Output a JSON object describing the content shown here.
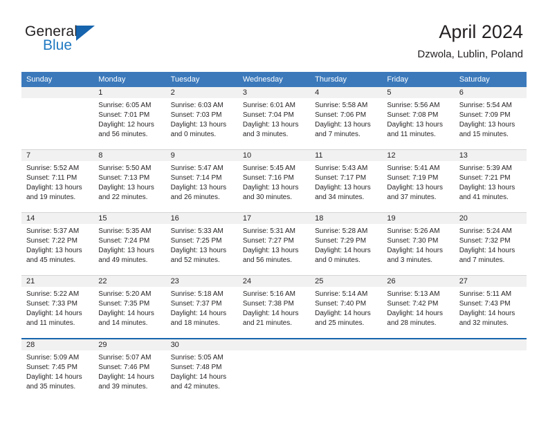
{
  "logo": {
    "word1": "General",
    "word2": "Blue",
    "triangle_icon": "triangle-icon",
    "accent_color": "#1664ad",
    "blue_text_color": "#1f78c1"
  },
  "header": {
    "title": "April 2024",
    "subtitle": "Dzwola, Lublin, Poland"
  },
  "calendar": {
    "header_bg": "#3b79bb",
    "daynum_band_bg": "#f1f1f1",
    "weekdays": [
      "Sunday",
      "Monday",
      "Tuesday",
      "Wednesday",
      "Thursday",
      "Friday",
      "Saturday"
    ],
    "weeks": [
      {
        "separator": "none",
        "days": [
          {
            "num": "",
            "sunrise": "",
            "sunset": "",
            "daylight_line1": "",
            "daylight_line2": "",
            "empty": true
          },
          {
            "num": "1",
            "sunrise": "Sunrise: 6:05 AM",
            "sunset": "Sunset: 7:01 PM",
            "daylight_line1": "Daylight: 12 hours",
            "daylight_line2": "and 56 minutes."
          },
          {
            "num": "2",
            "sunrise": "Sunrise: 6:03 AM",
            "sunset": "Sunset: 7:03 PM",
            "daylight_line1": "Daylight: 13 hours",
            "daylight_line2": "and 0 minutes."
          },
          {
            "num": "3",
            "sunrise": "Sunrise: 6:01 AM",
            "sunset": "Sunset: 7:04 PM",
            "daylight_line1": "Daylight: 13 hours",
            "daylight_line2": "and 3 minutes."
          },
          {
            "num": "4",
            "sunrise": "Sunrise: 5:58 AM",
            "sunset": "Sunset: 7:06 PM",
            "daylight_line1": "Daylight: 13 hours",
            "daylight_line2": "and 7 minutes."
          },
          {
            "num": "5",
            "sunrise": "Sunrise: 5:56 AM",
            "sunset": "Sunset: 7:08 PM",
            "daylight_line1": "Daylight: 13 hours",
            "daylight_line2": "and 11 minutes."
          },
          {
            "num": "6",
            "sunrise": "Sunrise: 5:54 AM",
            "sunset": "Sunset: 7:09 PM",
            "daylight_line1": "Daylight: 13 hours",
            "daylight_line2": "and 15 minutes."
          }
        ]
      },
      {
        "separator": "gray",
        "days": [
          {
            "num": "7",
            "sunrise": "Sunrise: 5:52 AM",
            "sunset": "Sunset: 7:11 PM",
            "daylight_line1": "Daylight: 13 hours",
            "daylight_line2": "and 19 minutes."
          },
          {
            "num": "8",
            "sunrise": "Sunrise: 5:50 AM",
            "sunset": "Sunset: 7:13 PM",
            "daylight_line1": "Daylight: 13 hours",
            "daylight_line2": "and 22 minutes."
          },
          {
            "num": "9",
            "sunrise": "Sunrise: 5:47 AM",
            "sunset": "Sunset: 7:14 PM",
            "daylight_line1": "Daylight: 13 hours",
            "daylight_line2": "and 26 minutes."
          },
          {
            "num": "10",
            "sunrise": "Sunrise: 5:45 AM",
            "sunset": "Sunset: 7:16 PM",
            "daylight_line1": "Daylight: 13 hours",
            "daylight_line2": "and 30 minutes."
          },
          {
            "num": "11",
            "sunrise": "Sunrise: 5:43 AM",
            "sunset": "Sunset: 7:17 PM",
            "daylight_line1": "Daylight: 13 hours",
            "daylight_line2": "and 34 minutes."
          },
          {
            "num": "12",
            "sunrise": "Sunrise: 5:41 AM",
            "sunset": "Sunset: 7:19 PM",
            "daylight_line1": "Daylight: 13 hours",
            "daylight_line2": "and 37 minutes."
          },
          {
            "num": "13",
            "sunrise": "Sunrise: 5:39 AM",
            "sunset": "Sunset: 7:21 PM",
            "daylight_line1": "Daylight: 13 hours",
            "daylight_line2": "and 41 minutes."
          }
        ]
      },
      {
        "separator": "gray",
        "days": [
          {
            "num": "14",
            "sunrise": "Sunrise: 5:37 AM",
            "sunset": "Sunset: 7:22 PM",
            "daylight_line1": "Daylight: 13 hours",
            "daylight_line2": "and 45 minutes."
          },
          {
            "num": "15",
            "sunrise": "Sunrise: 5:35 AM",
            "sunset": "Sunset: 7:24 PM",
            "daylight_line1": "Daylight: 13 hours",
            "daylight_line2": "and 49 minutes."
          },
          {
            "num": "16",
            "sunrise": "Sunrise: 5:33 AM",
            "sunset": "Sunset: 7:25 PM",
            "daylight_line1": "Daylight: 13 hours",
            "daylight_line2": "and 52 minutes."
          },
          {
            "num": "17",
            "sunrise": "Sunrise: 5:31 AM",
            "sunset": "Sunset: 7:27 PM",
            "daylight_line1": "Daylight: 13 hours",
            "daylight_line2": "and 56 minutes."
          },
          {
            "num": "18",
            "sunrise": "Sunrise: 5:28 AM",
            "sunset": "Sunset: 7:29 PM",
            "daylight_line1": "Daylight: 14 hours",
            "daylight_line2": "and 0 minutes."
          },
          {
            "num": "19",
            "sunrise": "Sunrise: 5:26 AM",
            "sunset": "Sunset: 7:30 PM",
            "daylight_line1": "Daylight: 14 hours",
            "daylight_line2": "and 3 minutes."
          },
          {
            "num": "20",
            "sunrise": "Sunrise: 5:24 AM",
            "sunset": "Sunset: 7:32 PM",
            "daylight_line1": "Daylight: 14 hours",
            "daylight_line2": "and 7 minutes."
          }
        ]
      },
      {
        "separator": "gray",
        "days": [
          {
            "num": "21",
            "sunrise": "Sunrise: 5:22 AM",
            "sunset": "Sunset: 7:33 PM",
            "daylight_line1": "Daylight: 14 hours",
            "daylight_line2": "and 11 minutes."
          },
          {
            "num": "22",
            "sunrise": "Sunrise: 5:20 AM",
            "sunset": "Sunset: 7:35 PM",
            "daylight_line1": "Daylight: 14 hours",
            "daylight_line2": "and 14 minutes."
          },
          {
            "num": "23",
            "sunrise": "Sunrise: 5:18 AM",
            "sunset": "Sunset: 7:37 PM",
            "daylight_line1": "Daylight: 14 hours",
            "daylight_line2": "and 18 minutes."
          },
          {
            "num": "24",
            "sunrise": "Sunrise: 5:16 AM",
            "sunset": "Sunset: 7:38 PM",
            "daylight_line1": "Daylight: 14 hours",
            "daylight_line2": "and 21 minutes."
          },
          {
            "num": "25",
            "sunrise": "Sunrise: 5:14 AM",
            "sunset": "Sunset: 7:40 PM",
            "daylight_line1": "Daylight: 14 hours",
            "daylight_line2": "and 25 minutes."
          },
          {
            "num": "26",
            "sunrise": "Sunrise: 5:13 AM",
            "sunset": "Sunset: 7:42 PM",
            "daylight_line1": "Daylight: 14 hours",
            "daylight_line2": "and 28 minutes."
          },
          {
            "num": "27",
            "sunrise": "Sunrise: 5:11 AM",
            "sunset": "Sunset: 7:43 PM",
            "daylight_line1": "Daylight: 14 hours",
            "daylight_line2": "and 32 minutes."
          }
        ]
      },
      {
        "separator": "blue",
        "days": [
          {
            "num": "28",
            "sunrise": "Sunrise: 5:09 AM",
            "sunset": "Sunset: 7:45 PM",
            "daylight_line1": "Daylight: 14 hours",
            "daylight_line2": "and 35 minutes."
          },
          {
            "num": "29",
            "sunrise": "Sunrise: 5:07 AM",
            "sunset": "Sunset: 7:46 PM",
            "daylight_line1": "Daylight: 14 hours",
            "daylight_line2": "and 39 minutes."
          },
          {
            "num": "30",
            "sunrise": "Sunrise: 5:05 AM",
            "sunset": "Sunset: 7:48 PM",
            "daylight_line1": "Daylight: 14 hours",
            "daylight_line2": "and 42 minutes."
          },
          {
            "num": "",
            "sunrise": "",
            "sunset": "",
            "daylight_line1": "",
            "daylight_line2": "",
            "empty": true
          },
          {
            "num": "",
            "sunrise": "",
            "sunset": "",
            "daylight_line1": "",
            "daylight_line2": "",
            "empty": true
          },
          {
            "num": "",
            "sunrise": "",
            "sunset": "",
            "daylight_line1": "",
            "daylight_line2": "",
            "empty": true
          },
          {
            "num": "",
            "sunrise": "",
            "sunset": "",
            "daylight_line1": "",
            "daylight_line2": "",
            "empty": true
          }
        ]
      }
    ]
  }
}
